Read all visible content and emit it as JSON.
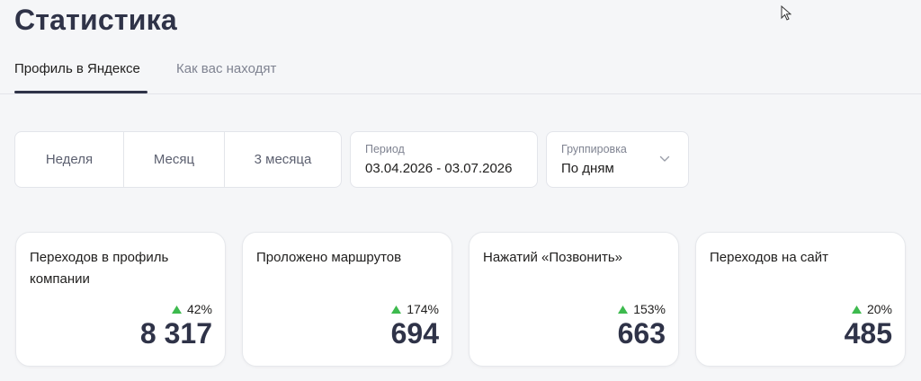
{
  "page": {
    "title": "Статистика"
  },
  "tabs": [
    {
      "label": "Профиль в Яндексе",
      "active": true
    },
    {
      "label": "Как вас находят",
      "active": false
    }
  ],
  "filters": {
    "periods": [
      "Неделя",
      "Месяц",
      "3 месяца"
    ],
    "period": {
      "label": "Период",
      "value": "03.04.2026 - 03.07.2026"
    },
    "grouping": {
      "label": "Группировка",
      "value": "По дням"
    }
  },
  "colors": {
    "accent": "#2f3348",
    "delta_up": "#3dba4e"
  },
  "cards": [
    {
      "title": "Переходов в профиль компании",
      "delta": "42%",
      "value": "8 317"
    },
    {
      "title": "Проложено маршрутов",
      "delta": "174%",
      "value": "694"
    },
    {
      "title": "Нажатий «Позвонить»",
      "delta": "153%",
      "value": "663"
    },
    {
      "title": "Переходов на сайт",
      "delta": "20%",
      "value": "485"
    }
  ]
}
